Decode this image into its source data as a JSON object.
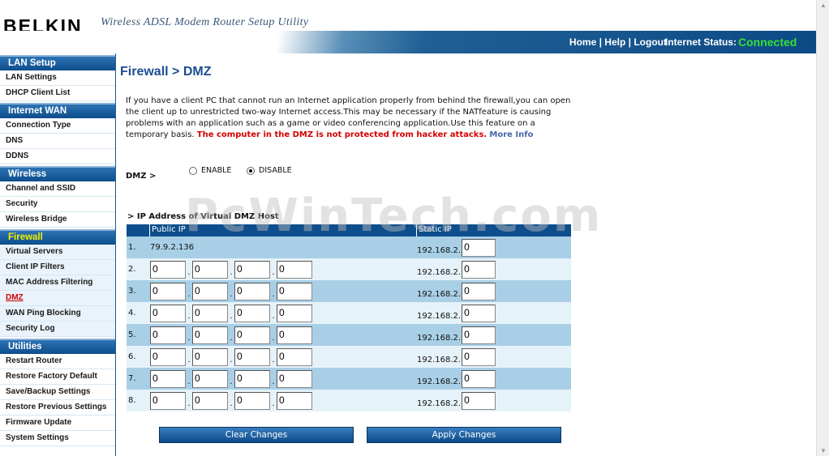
{
  "header": {
    "logo": "BELKIN",
    "tagline": "Wireless ADSL Modem Router Setup Utility",
    "links": [
      "Home",
      "Help",
      "Logout"
    ],
    "status_label": "Internet Status:",
    "status_value": "Connected"
  },
  "sidebar": {
    "sections": [
      {
        "title": "LAN Setup",
        "items": [
          "LAN Settings",
          "DHCP Client List"
        ]
      },
      {
        "title": "Internet WAN",
        "items": [
          "Connection Type",
          "DNS",
          "DDNS"
        ]
      },
      {
        "title": "Wireless",
        "items": [
          "Channel and SSID",
          "Security",
          "Wireless Bridge"
        ]
      },
      {
        "title": "Firewall",
        "items": [
          "Virtual Servers",
          "Client IP Filters",
          "MAC Address Filtering",
          "DMZ",
          "WAN Ping Blocking",
          "Security Log"
        ]
      },
      {
        "title": "Utilities",
        "items": [
          "Restart Router",
          "Restore Factory Default",
          "Save/Backup Settings",
          "Restore Previous Settings",
          "Firmware Update",
          "System Settings"
        ]
      }
    ]
  },
  "main": {
    "title": "Firewall > DMZ",
    "description": "If you have a client PC that cannot run an Internet application properly from behind the firewall,you can open the client up to unrestricted two-way Internet access.This may be necessary if the NATfeature is causing problems with an application such as a game or video conferencing application.Use this feature on a temporary basis. ",
    "warning": "The computer in the DMZ is not protected from hacker attacks.",
    "more_info": "More Info",
    "dmz_label": "DMZ >",
    "enable_label": "ENABLE",
    "disable_label": "DISABLE",
    "ip_title": "> IP Address of Virtual DMZ Host",
    "watermark": "PcWinTech.com",
    "table": {
      "col_public": "Public IP",
      "col_static": "Static IP",
      "static_prefix": "192.168.2.",
      "rows": [
        {
          "num": "1.",
          "public": "79.9.2.136",
          "octets": null,
          "static": "0"
        },
        {
          "num": "2.",
          "public": null,
          "octets": [
            "0",
            "0",
            "0",
            "0"
          ],
          "static": "0"
        },
        {
          "num": "3.",
          "public": null,
          "octets": [
            "0",
            "0",
            "0",
            "0"
          ],
          "static": "0"
        },
        {
          "num": "4.",
          "public": null,
          "octets": [
            "0",
            "0",
            "0",
            "0"
          ],
          "static": "0"
        },
        {
          "num": "5.",
          "public": null,
          "octets": [
            "0",
            "0",
            "0",
            "0"
          ],
          "static": "0"
        },
        {
          "num": "6.",
          "public": null,
          "octets": [
            "0",
            "0",
            "0",
            "0"
          ],
          "static": "0"
        },
        {
          "num": "7.",
          "public": null,
          "octets": [
            "0",
            "0",
            "0",
            "0"
          ],
          "static": "0"
        },
        {
          "num": "8.",
          "public": null,
          "octets": [
            "0",
            "0",
            "0",
            "0"
          ],
          "static": "0"
        }
      ]
    },
    "buttons": {
      "clear": "Clear Changes",
      "apply": "Apply Changes"
    }
  },
  "colors": {
    "accent": "#0e4e8c",
    "connected": "#36e036",
    "warning": "#d40000"
  }
}
